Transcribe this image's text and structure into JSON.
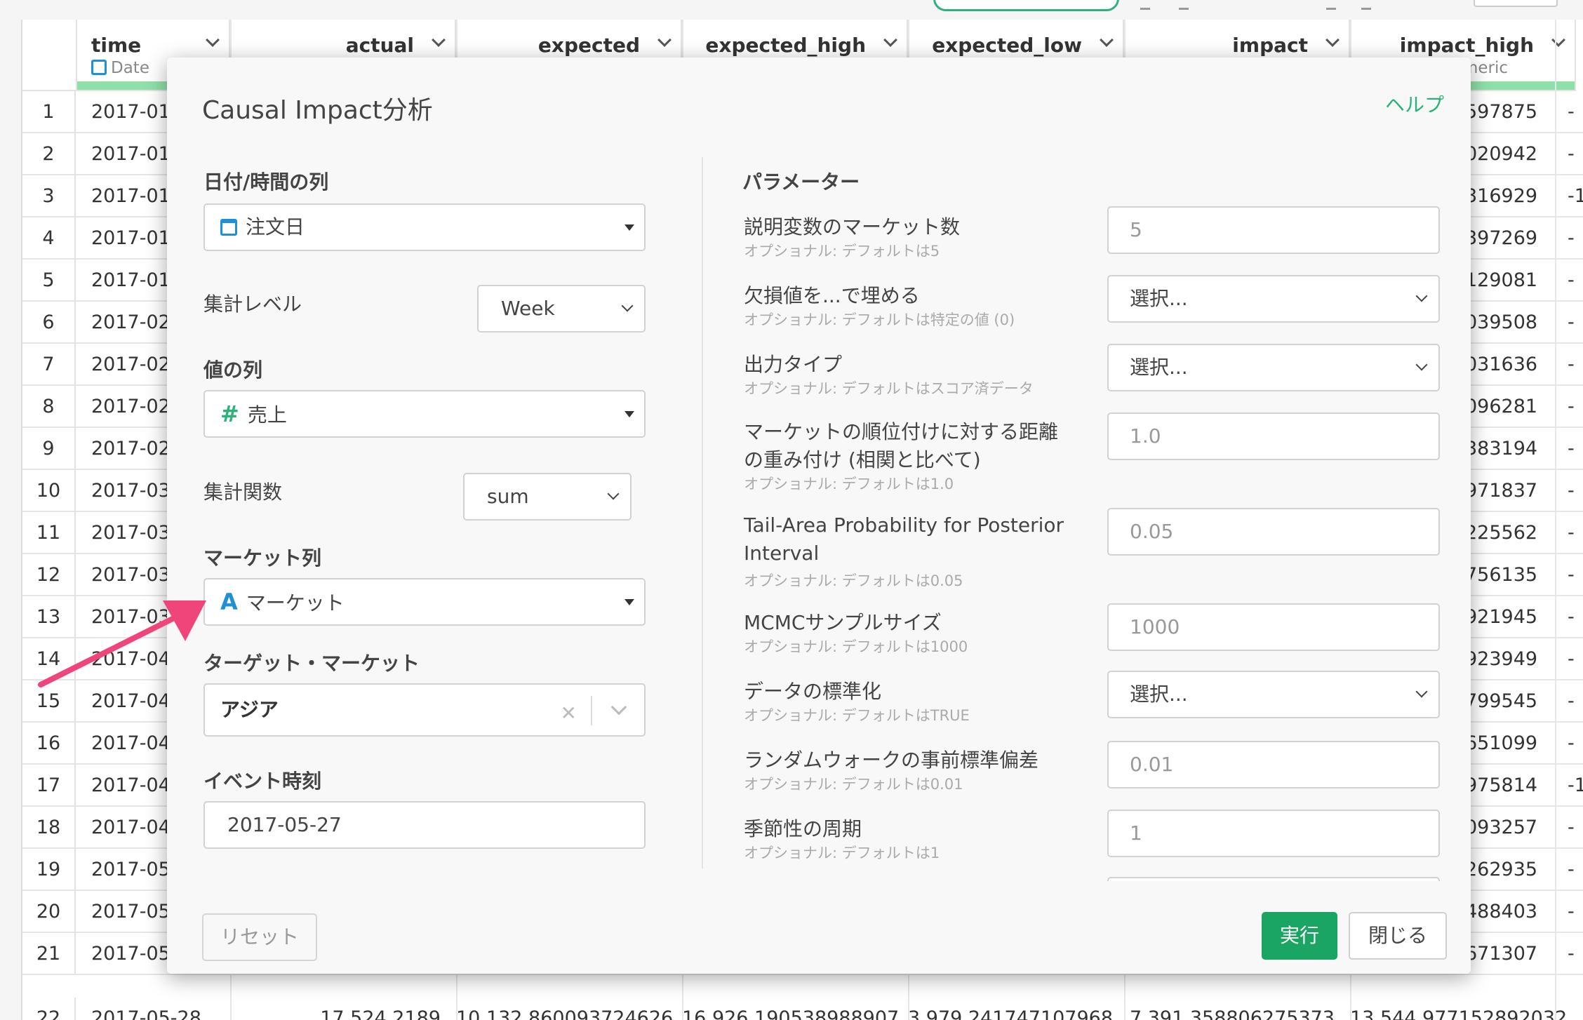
{
  "toolbar": {
    "left_items": [
      "",
      "",
      ""
    ]
  },
  "grid": {
    "columns": [
      {
        "name": "time",
        "type": "Date"
      },
      {
        "name": "actual"
      },
      {
        "name": "expected"
      },
      {
        "name": "expected_high"
      },
      {
        "name": "expected_low"
      },
      {
        "name": "impact"
      },
      {
        "name": "impact_high",
        "type": "meric"
      }
    ],
    "rows": [
      {
        "num": "1",
        "date": "2017-01-",
        "right": "597875",
        "far": "-"
      },
      {
        "num": "2",
        "date": "2017-01-",
        "right": "020942",
        "far": "-"
      },
      {
        "num": "3",
        "date": "2017-01-",
        "right": "316929",
        "far": "-1"
      },
      {
        "num": "4",
        "date": "2017-01-",
        "right": "397269",
        "far": "-"
      },
      {
        "num": "5",
        "date": "2017-01-",
        "right": "129081",
        "far": "-"
      },
      {
        "num": "6",
        "date": "2017-02-",
        "right": "039508",
        "far": "-"
      },
      {
        "num": "7",
        "date": "2017-02-",
        "right": "031636",
        "far": "-"
      },
      {
        "num": "8",
        "date": "2017-02-",
        "right": "096281",
        "far": "-"
      },
      {
        "num": "9",
        "date": "2017-02-",
        "right": "383194",
        "far": "-"
      },
      {
        "num": "10",
        "date": "2017-03-",
        "right": "971837",
        "far": "-"
      },
      {
        "num": "11",
        "date": "2017-03-",
        "right": "225562",
        "far": "-"
      },
      {
        "num": "12",
        "date": "2017-03-",
        "right": "756135",
        "far": "-"
      },
      {
        "num": "13",
        "date": "2017-03",
        "right": "921945",
        "far": "-"
      },
      {
        "num": "14",
        "date": "2017-04-",
        "right": "923949",
        "far": "-"
      },
      {
        "num": "15",
        "date": "2017-04-",
        "right": "799545",
        "far": "-"
      },
      {
        "num": "16",
        "date": "2017-04-",
        "right": "651099",
        "far": "-"
      },
      {
        "num": "17",
        "date": "2017-04-",
        "right": "975814",
        "far": "-1"
      },
      {
        "num": "18",
        "date": "2017-04-",
        "right": "093257",
        "far": "-"
      },
      {
        "num": "19",
        "date": "2017-05-",
        "right": "262935",
        "far": "-"
      },
      {
        "num": "20",
        "date": "2017-05-",
        "right": "488403",
        "far": "-"
      },
      {
        "num": "21",
        "date": "2017-05-",
        "right": "671307",
        "far": "-"
      }
    ],
    "last_row": {
      "num": "22",
      "date": "2017-05-28",
      "actual": "17,524.2189",
      "expected": "10,132.860093724626",
      "expected_high": "16,926.190538988907",
      "expected_low": "3,979.241747107968",
      "impact": "7,391.358806275373",
      "impact_high": "13,544.977152892032"
    }
  },
  "modal": {
    "title": "Causal Impact分析",
    "help": "ヘルプ",
    "left": {
      "date_col_label": "日付/時間の列",
      "date_col_value": "注文日",
      "agg_level_label": "集計レベル",
      "agg_level_value": "Week",
      "value_col_label": "値の列",
      "value_col_value": "売上",
      "agg_fn_label": "集計関数",
      "agg_fn_value": "sum",
      "market_col_label": "マーケット列",
      "market_col_value": "マーケット",
      "target_market_label": "ターゲット・マーケット",
      "target_market_value": "アジア",
      "event_time_label": "イベント時刻",
      "event_time_value": "2017-05-27"
    },
    "right": {
      "heading": "パラメーター",
      "params": [
        {
          "label": "説明変数のマーケット数",
          "hint": "オプショナル: デフォルトは5",
          "value": "5",
          "kind": "input"
        },
        {
          "label": "欠損値を...で埋める",
          "hint": "オプショナル: デフォルトは特定の値 (0)",
          "value": "選択...",
          "kind": "select"
        },
        {
          "label": "出力タイプ",
          "hint": "オプショナル: デフォルトはスコア済データ",
          "value": "選択...",
          "kind": "select"
        },
        {
          "label": "マーケットの順位付けに対する距離の重み付け (相関と比べて)",
          "label_line1": "マーケットの順位付けに対する距離",
          "label_line2": "の重み付け (相関と比べて)",
          "hint": "オプショナル: デフォルトは1.0",
          "value": "1.0",
          "kind": "input"
        },
        {
          "label": "Tail-Area Probability for Posterior Interval",
          "label_line1": "Tail-Area Probability for Posterior",
          "label_line2": "Interval",
          "hint": "オプショナル: デフォルトは0.05",
          "value": "0.05",
          "kind": "input"
        },
        {
          "label": "MCMCサンプルサイズ",
          "hint": "オプショナル: デフォルトは1000",
          "value": "1000",
          "kind": "input"
        },
        {
          "label": "データの標準化",
          "hint": "オプショナル: デフォルトはTRUE",
          "value": "選択...",
          "kind": "select"
        },
        {
          "label": "ランダムウォークの事前標準偏差",
          "hint": "オプショナル: デフォルトは0.01",
          "value": "0.01",
          "kind": "input"
        },
        {
          "label": "季節性の周期",
          "hint": "オプショナル: デフォルトは1",
          "value": "1",
          "kind": "input"
        }
      ]
    },
    "buttons": {
      "reset": "リセット",
      "run": "実行",
      "close": "閉じる"
    }
  },
  "colors": {
    "accent": "#1aa564",
    "link": "#28b37a",
    "arrow": "#f0457a",
    "date_icon": "#1e90d8",
    "number_icon": "#2db37a"
  }
}
